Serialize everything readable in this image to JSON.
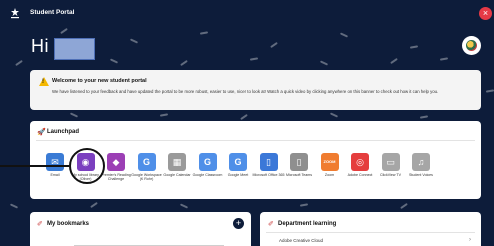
{
  "header": {
    "portal_title": "Student Portal",
    "greeting": "Hi",
    "close_glyph": "×"
  },
  "banner": {
    "icon": "warning-icon",
    "title": "Welcome to your new student portal",
    "body": "We have listened to your feedback and have updated the portal to be more robust, easier to use, nicer to look at! Watch a quick video by clicking anywhere on this banner to check out how it can help you.",
    "close": "×"
  },
  "launchpad": {
    "title": "Launchpad",
    "apps": [
      {
        "label": "Email",
        "icon": "email-icon",
        "color": "#3a7bd5",
        "glyph": "✉"
      },
      {
        "label": "My school library (Oliver)",
        "icon": "library-icon",
        "color": "#7b3fbf",
        "glyph": "◉"
      },
      {
        "label": "Premier's Reading Challenge",
        "icon": "book-icon",
        "color": "#9c3fb5",
        "glyph": "◆"
      },
      {
        "label": "Google Workspace (K Rohr)",
        "icon": "google-workspace-icon",
        "color": "#4f8fe8",
        "glyph": "G"
      },
      {
        "label": "Google Calendar",
        "icon": "calendar-icon",
        "color": "#9a9a9a",
        "glyph": "▦"
      },
      {
        "label": "Google Classroom",
        "icon": "classroom-icon",
        "color": "#4f8fe8",
        "glyph": "G"
      },
      {
        "label": "Google Meet",
        "icon": "meet-icon",
        "color": "#4f8fe8",
        "glyph": "G"
      },
      {
        "label": "Microsoft Office 365",
        "icon": "office-icon",
        "color": "#3b78d8",
        "glyph": "▯"
      },
      {
        "label": "Microsoft Teams",
        "icon": "teams-icon",
        "color": "#8f8f8f",
        "glyph": "▯"
      },
      {
        "label": "Zoom",
        "icon": "zoom-icon",
        "color": "#f07c2f",
        "glyph": "ZOOM"
      },
      {
        "label": "Adobe Connect",
        "icon": "adobe-icon",
        "color": "#e53e3e",
        "glyph": "◎"
      },
      {
        "label": "ClickView TV",
        "icon": "tv-icon",
        "color": "#a6a6a6",
        "glyph": "▭"
      },
      {
        "label": "Student Voices",
        "icon": "voices-icon",
        "color": "#a6a6a6",
        "glyph": "♫"
      }
    ]
  },
  "bookmarks": {
    "title": "My bookmarks",
    "add_glyph": "+"
  },
  "department_learning": {
    "title": "Department learning",
    "items": [
      "Adobe Creative Cloud"
    ],
    "chevron": "›"
  },
  "colors": {
    "background": "#0d1c3a",
    "accent_red": "#e63946"
  }
}
